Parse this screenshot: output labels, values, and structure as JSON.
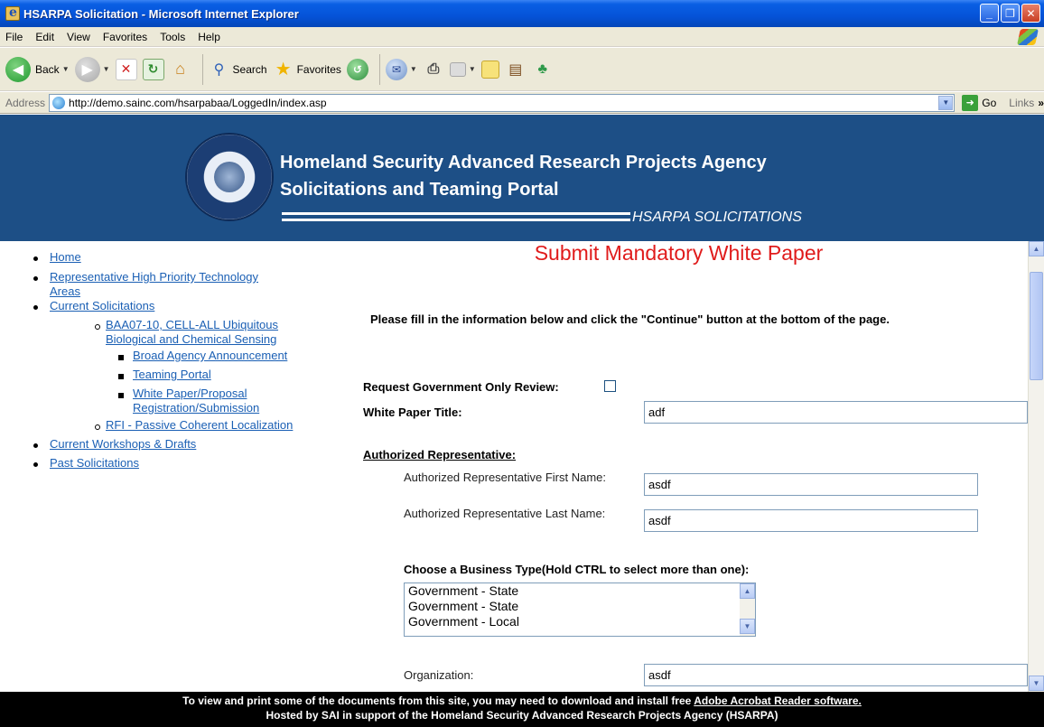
{
  "window": {
    "title": "HSARPA Solicitation - Microsoft Internet Explorer",
    "buttons": [
      "_",
      "❐",
      "✕"
    ]
  },
  "menu": [
    "File",
    "Edit",
    "View",
    "Favorites",
    "Tools",
    "Help"
  ],
  "toolbar": {
    "back_label": "Back",
    "search_label": "Search",
    "favorites_label": "Favorites"
  },
  "address": {
    "label": "Address",
    "url": "http://demo.sainc.com/hsarpabaa/LoggedIn/index.asp",
    "go_label": "Go",
    "links_label": "Links"
  },
  "banner": {
    "line1": "Homeland Security Advanced Research Projects Agency",
    "line2": "Solicitations and Teaming Portal",
    "line3": "HSARPA SOLICITATIONS"
  },
  "nav": {
    "home": "Home",
    "rhpta_1": "Representative High Priority Technology",
    "rhpta_2": "Areas",
    "current": "Current Solicitations",
    "baa_1": "BAA07-10, CELL-ALL Ubiquitous",
    "baa_2": "Biological and Chemical Sensing",
    "broad": "Broad Agency Announcement",
    "teaming": "Teaming Portal",
    "wp_1": "White Paper/Proposal",
    "wp_2": "Registration/Submission",
    "rfi": "RFI - Passive Coherent Localization",
    "workshops": "Current Workshops & Drafts",
    "past": "Past Solicitations"
  },
  "form": {
    "page_title": "Submit Mandatory White Paper",
    "instructions": "Please fill in the information below and click the \"Continue\" button at the bottom of the page.",
    "gov_review_label": "Request Government Only Review:",
    "gov_review_checked": false,
    "wp_title_label": "White Paper Title:",
    "wp_title_value": "adf",
    "auth_rep_heading": "Authorized Representative:",
    "first_name_label": "Authorized Representative First Name:",
    "first_name_value": "asdf",
    "last_name_label": "Authorized Representative Last Name:",
    "last_name_value": "asdf",
    "business_type_label": "Choose a Business Type(Hold CTRL to select more than one):",
    "business_types": [
      "Government - State",
      "Government - State",
      "Government - Local"
    ],
    "organization_label": "Organization:",
    "organization_value": "asdf"
  },
  "footer": {
    "line1_text": "To view and print some of the documents from this site, you may need to download and install free ",
    "line1_link": "Adobe Acrobat Reader software.",
    "line2": "Hosted by SAI in support of the Homeland Security Advanced Research Projects Agency (HSARPA)"
  }
}
